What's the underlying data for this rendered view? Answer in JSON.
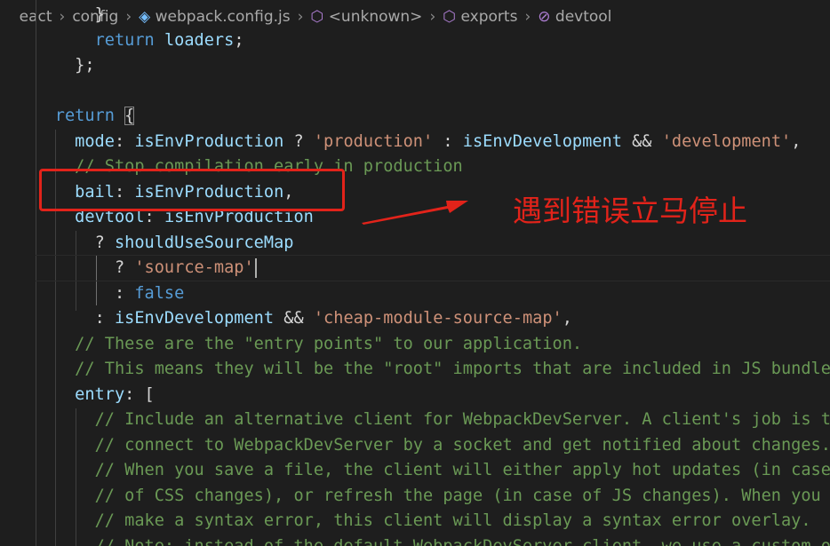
{
  "breadcrumb": {
    "items": [
      "eact",
      "config",
      "webpack.config.js",
      "<unknown>",
      "exports",
      "devtool"
    ],
    "separator": ">"
  },
  "code": {
    "line1": "}",
    "line2_kw": "return",
    "line2_var": "loaders",
    "line2_end": ";",
    "line3": "};",
    "line5_kw": "return",
    "line5_brace": "{",
    "line6_key": "mode",
    "line6_var1": "isEnvProduction",
    "line6_q": " ? ",
    "line6_str1": "'production'",
    "line6_c": " : ",
    "line6_var2": "isEnvDevelopment",
    "line6_and": " && ",
    "line6_str2": "'development'",
    "line6_end": ",",
    "line7_cmt": "// Stop compilation early in production",
    "line8_key": "bail",
    "line8_var": "isEnvProduction",
    "line8_end": ",",
    "line9_key": "devtool",
    "line9_var": "isEnvProduction",
    "line10_q": "? ",
    "line10_var": "shouldUseSourceMap",
    "line11_q": "? ",
    "line11_str": "'source-map'",
    "line12_c": ": ",
    "line12_bool": "false",
    "line13_c": ": ",
    "line13_var": "isEnvDevelopment",
    "line13_and": " && ",
    "line13_str": "'cheap-module-source-map'",
    "line13_end": ",",
    "line14_cmt": "// These are the \"entry points\" to our application.",
    "line15_cmt": "// This means they will be the \"root\" imports that are included in JS bundle.",
    "line16_key": "entry",
    "line16_end": ": [",
    "line17_cmt": "// Include an alternative client for WebpackDevServer. A client's job is to",
    "line18_cmt": "// connect to WebpackDevServer by a socket and get notified about changes.",
    "line19_cmt": "// When you save a file, the client will either apply hot updates (in case",
    "line20_cmt": "// of CSS changes), or refresh the page (in case of JS changes). When you",
    "line21_cmt": "// make a syntax error, this client will display a syntax error overlay.",
    "line22_cmt": "// Note: instead of the default WebpackDevServer client, we use a custom one"
  },
  "annotation": {
    "text": "遇到错误立马停止",
    "color": "#e2231a"
  },
  "colors": {
    "background": "#1e1e1e",
    "keyword": "#569cd6",
    "variable": "#9cdcfe",
    "string": "#ce9178",
    "comment": "#6a9955"
  }
}
